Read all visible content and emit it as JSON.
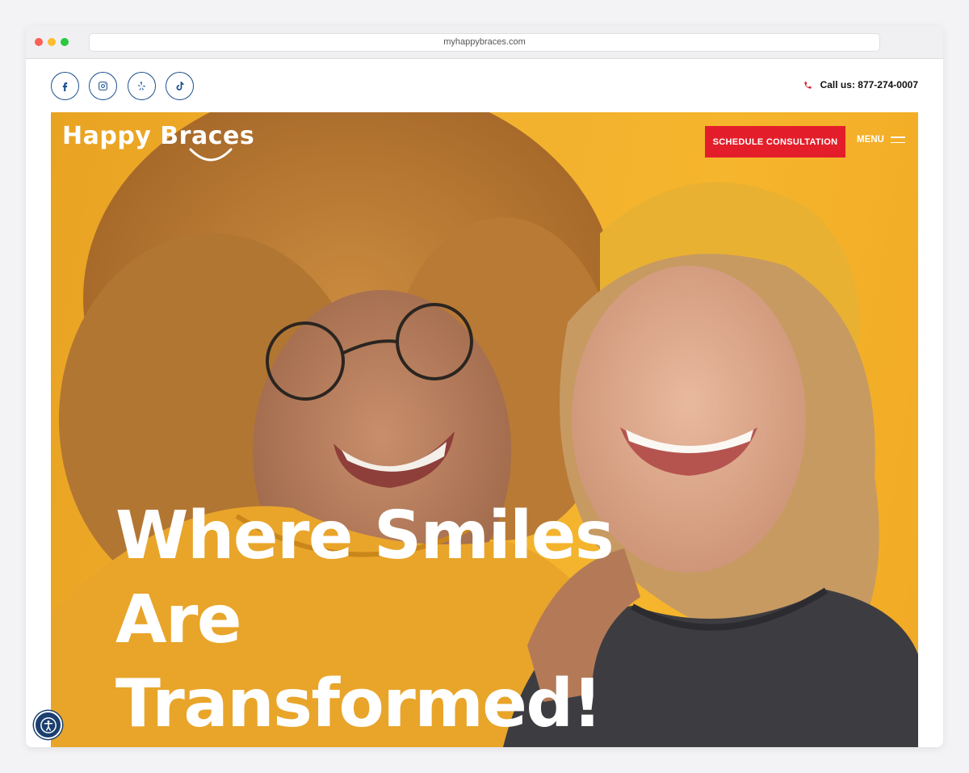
{
  "browser": {
    "url": "myhappybraces.com"
  },
  "social": [
    {
      "name": "facebook-icon"
    },
    {
      "name": "instagram-icon"
    },
    {
      "name": "yelp-icon"
    },
    {
      "name": "tiktok-icon"
    }
  ],
  "contact": {
    "call_text": "Call us: 877-274-0007",
    "icon": "phone-icon"
  },
  "header": {
    "logo_text": "Happy Braces",
    "cta_label": "SCHEDULE CONSULTATION",
    "menu_label": "MENU"
  },
  "hero": {
    "headline_lines": [
      "Where Smiles",
      "Are",
      "Transformed!"
    ]
  },
  "colors": {
    "brand_blue": "#1c4f8c",
    "cta_red": "#e31e2a",
    "hero_yellow": "#f2b12f"
  }
}
